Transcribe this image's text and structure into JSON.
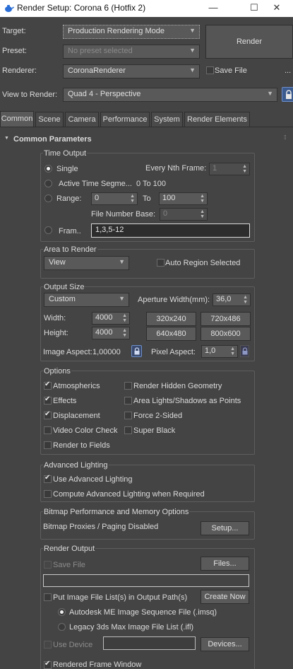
{
  "window": {
    "title": "Render Setup: Corona 6 (Hotfix 2)",
    "minimize_glyph": "—",
    "maximize_glyph": "☐",
    "close_glyph": "✕"
  },
  "top": {
    "target_label": "Target:",
    "target_value": "Production Rendering Mode",
    "preset_label": "Preset:",
    "preset_value": "No preset selected",
    "renderer_label": "Renderer:",
    "renderer_value": "CoronaRenderer",
    "save_file_label": "Save File",
    "more_label": "...",
    "view_label": "View to Render:",
    "view_value": "Quad 4 - Perspective",
    "render_button": "Render"
  },
  "tabs": [
    "Common",
    "Scene",
    "Camera",
    "Performance",
    "System",
    "Render Elements"
  ],
  "rollout": {
    "title": "Common Parameters",
    "collapse_glyph": "▼"
  },
  "time_output": {
    "title": "Time Output",
    "single": "Single",
    "every_nth_label": "Every Nth Frame:",
    "every_nth_value": "1",
    "active_segment": "Active Time Segme...",
    "active_range": "0 To 100",
    "range": "Range:",
    "range_from": "0",
    "range_to_label": "To",
    "range_to": "100",
    "file_number_base_label": "File Number Base:",
    "file_number_base_value": "0",
    "frames": "Fram..",
    "frames_value": "1,3,5-12"
  },
  "area": {
    "title": "Area to Render",
    "value": "View",
    "auto_region": "Auto Region Selected"
  },
  "output_size": {
    "title": "Output Size",
    "preset": "Custom",
    "aperture_label": "Aperture Width(mm):",
    "aperture_value": "36,0",
    "width_label": "Width:",
    "width_value": "4000",
    "height_label": "Height:",
    "height_value": "4000",
    "presets": [
      "320x240",
      "720x486",
      "640x480",
      "800x600"
    ],
    "image_aspect_label": "Image Aspect:",
    "image_aspect_value": "1,00000",
    "pixel_aspect_label": "Pixel Aspect:",
    "pixel_aspect_value": "1,0"
  },
  "options": {
    "title": "Options",
    "atmospherics": "Atmospherics",
    "render_hidden": "Render Hidden Geometry",
    "effects": "Effects",
    "area_lights": "Area Lights/Shadows as Points",
    "displacement": "Displacement",
    "force_2sided": "Force 2-Sided",
    "video_color": "Video Color Check",
    "super_black": "Super Black",
    "render_fields": "Render to Fields"
  },
  "advanced_lighting": {
    "title": "Advanced Lighting",
    "use": "Use Advanced Lighting",
    "compute": "Compute Advanced Lighting when Required"
  },
  "bitmap": {
    "title": "Bitmap Performance and Memory Options",
    "status": "Bitmap Proxies / Paging Disabled",
    "setup_button": "Setup..."
  },
  "render_output": {
    "title": "Render Output",
    "save_file": "Save File",
    "files_button": "Files...",
    "put_image": "Put Image File List(s) in Output Path(s)",
    "create_now": "Create Now",
    "autodesk_me": "Autodesk ME Image Sequence File (.imsq)",
    "legacy": "Legacy 3ds Max Image File List (.ifl)",
    "use_device": "Use Device",
    "devices_button": "Devices...",
    "rendered_frame": "Rendered Frame Window"
  }
}
